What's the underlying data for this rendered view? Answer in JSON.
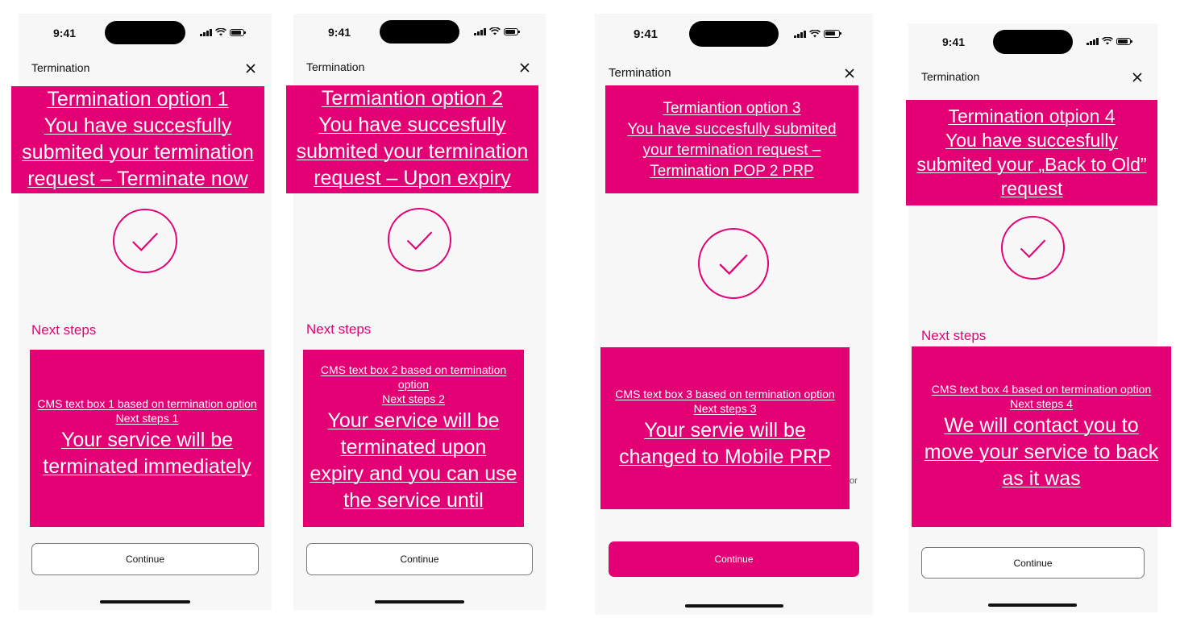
{
  "brand": {
    "accent": "#e20074"
  },
  "status_time": "9:41",
  "title": "Termination",
  "next_steps_label": "Next steps",
  "continue_label": "Continue",
  "screens": [
    {
      "banner": {
        "line1": "Termination option 1",
        "line2": "You have succesfully",
        "line3": "submited your termination",
        "line4": "request – Terminate now"
      },
      "cms": {
        "line1": "CMS text box 1 based on termination option",
        "line2": "Next steps 1"
      },
      "message": {
        "line1": "Your service will be",
        "line2": "terminated immediately"
      },
      "continue_style": "outline"
    },
    {
      "banner": {
        "line1": "Termiantion option 2",
        "line2": "You have succesfully",
        "line3": "submited your termination",
        "line4": "request – Upon expiry"
      },
      "cms": {
        "line1": "CMS text box 2 based on termination",
        "line1b": "option",
        "line2": "Next steps 2"
      },
      "message": {
        "line1": "Your service will be",
        "line2": "terminated upon",
        "line3": "expiry and you can use",
        "line4": "the service until"
      },
      "continue_style": "outline"
    },
    {
      "banner": {
        "line1": "Termiantion option 3",
        "line2": "You have succesfully submited",
        "line3": "your termination request –",
        "line4": "Termination POP 2 PRP"
      },
      "cms": {
        "line1": "CMS text box 3 based on termination option",
        "line2": "Next steps 3"
      },
      "message": {
        "line1": "Your servie will be",
        "line2": "changed to Mobile PRP"
      },
      "leftover_text": "or",
      "continue_style": "primary"
    },
    {
      "banner": {
        "line1": "Termination otpion 4",
        "line2": "You have succesfully",
        "line3": "submited your „Back to Old”",
        "line4": "request"
      },
      "cms": {
        "line1": "CMS text box 4 based on termination option",
        "line2": "Next steps 4"
      },
      "message": {
        "line1": "We will contact you to",
        "line2": "move your service to back",
        "line3": "as it was"
      },
      "continue_style": "outline"
    }
  ]
}
